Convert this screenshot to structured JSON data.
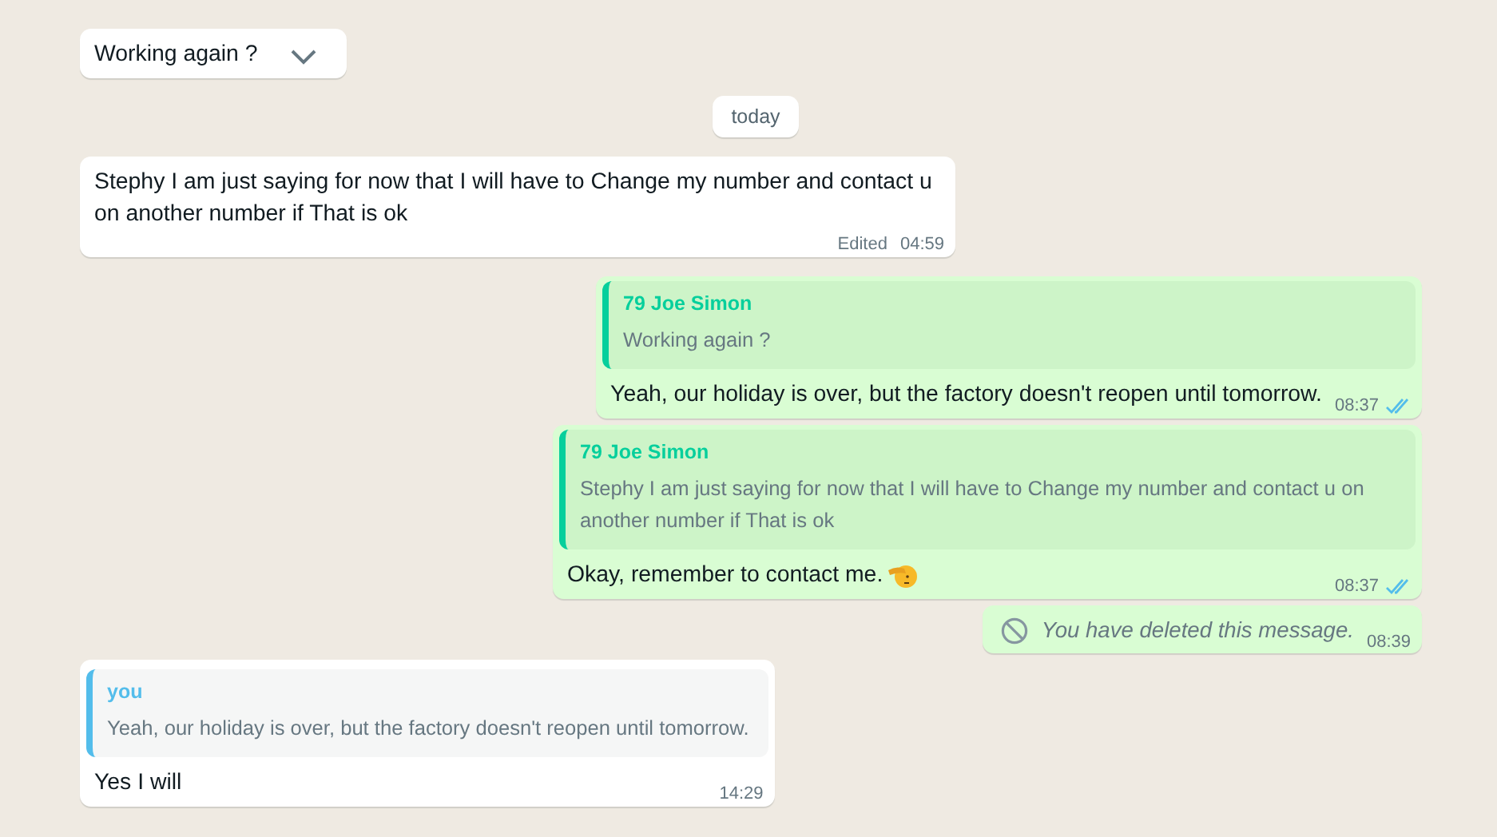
{
  "messages": [
    {
      "kind": "incoming",
      "text": "Working again ?",
      "has_menu": true
    },
    {
      "kind": "date",
      "text": "today"
    },
    {
      "kind": "incoming",
      "text": "Stephy I am just saying for now that I will have to Change my number and contact u on another number if That is ok",
      "edited": "Edited",
      "time": "04:59"
    },
    {
      "kind": "outgoing",
      "quote": {
        "author": "79 Joe Simon",
        "text": "Working again ?",
        "color": "#06cf9c"
      },
      "text": "Yeah, our holiday is over, but the factory doesn't reopen until tomorrow.",
      "time": "08:37",
      "read": true
    },
    {
      "kind": "outgoing",
      "quote": {
        "author": "79 Joe Simon",
        "text": "Stephy I am just saying for now that I will have to Change my number and contact u on another number if That is ok",
        "color": "#06cf9c"
      },
      "text": "Okay, remember to contact me.",
      "emoji": {
        "kind": "salute"
      },
      "time": "08:37",
      "read": true
    },
    {
      "kind": "deleted",
      "text": "You have deleted this message.",
      "time": "08:39"
    },
    {
      "kind": "incoming",
      "quote": {
        "author": "you",
        "text": "Yeah, our holiday is over, but the factory doesn't reopen until tomorrow.",
        "color": "#53bdeb"
      },
      "text": "Yes I will",
      "time": "14:29"
    }
  ]
}
